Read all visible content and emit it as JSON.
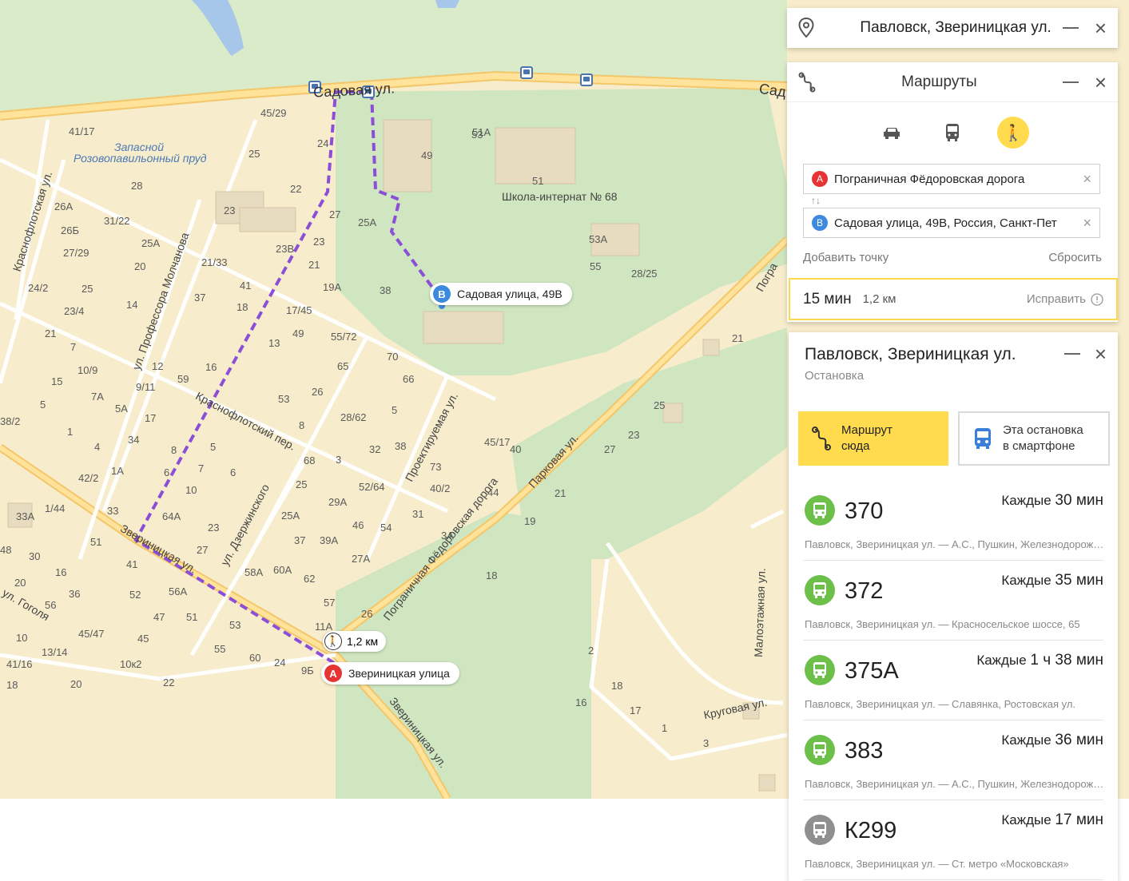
{
  "map": {
    "streets": [
      {
        "id": "sadovaya",
        "text": "Садовая ул."
      },
      {
        "id": "sad-edge",
        "text": "Сад"
      },
      {
        "id": "krasnoflotsky",
        "text": "Краснофлотский пер."
      },
      {
        "id": "molchanova",
        "text": "ул. Профессора Молчанова"
      },
      {
        "id": "dzerzhinskogo",
        "text": "ул. Дзержинского"
      },
      {
        "id": "proektiruemaya",
        "text": "Проектируемая ул."
      },
      {
        "id": "parkovaya",
        "text": "Парковая ул."
      },
      {
        "id": "pogranichnaya",
        "text": "Пограничная Фёдоровская дорога"
      },
      {
        "id": "zverinitskaya-a",
        "text": "Звериницкая ул."
      },
      {
        "id": "zverinitskaya-b",
        "text": "Звериницкая ул."
      },
      {
        "id": "gogolya",
        "text": "ул. Гоголя"
      },
      {
        "id": "krugovaya",
        "text": "Круговая ул."
      },
      {
        "id": "malоetazhnaya",
        "text": "Малоэтажная ул."
      },
      {
        "id": "krasnoflotskaya",
        "text": "Краснофлотская ул."
      },
      {
        "id": "pogra-edge",
        "text": "Погра"
      }
    ],
    "water": [
      "Запасной",
      "Розовопавильонный пруд"
    ],
    "school": "Школа-интернат № 68",
    "house_numbers": [
      "45/29",
      "41/17",
      "25",
      "24",
      "22",
      "28",
      "23",
      "27",
      "25А",
      "23В",
      "23",
      "21",
      "19А",
      "38",
      "49",
      "51А",
      "51",
      "53",
      "53А",
      "55",
      "28/25",
      "26А",
      "26Б",
      "27/29",
      "31/22",
      "25А",
      "20",
      "21/33",
      "41",
      "18",
      "17/45",
      "49",
      "55/72",
      "13",
      "37",
      "14",
      "25",
      "24/2",
      "23/4",
      "21",
      "7",
      "10/9",
      "9/11",
      "12",
      "16",
      "59",
      "70",
      "65",
      "66",
      "26",
      "53",
      "28/62",
      "8",
      "7А",
      "17",
      "15",
      "5",
      "5А",
      "34",
      "38/2",
      "1",
      "4",
      "1А",
      "6",
      "8",
      "5",
      "7",
      "10",
      "6",
      "5",
      "38",
      "32",
      "3",
      "68",
      "73",
      "45/17",
      "40",
      "42/2",
      "33",
      "1/44",
      "64А",
      "23",
      "25",
      "29А",
      "46",
      "54",
      "40/2",
      "44",
      "52/64",
      "31",
      "3А",
      "33А",
      "48",
      "51",
      "27",
      "25А",
      "27А",
      "37",
      "39А",
      "41",
      "52",
      "56А",
      "58А",
      "60А",
      "62",
      "57",
      "26",
      "18",
      "16",
      "30",
      "20",
      "36",
      "56",
      "45/47",
      "47",
      "45",
      "51",
      "53",
      "55",
      "60",
      "24",
      "9Б",
      "11А",
      "10к2",
      "10",
      "13/14",
      "41/16",
      "18",
      "20",
      "22",
      "21",
      "25",
      "27",
      "23",
      "21",
      "19",
      "2",
      "18",
      "17",
      "16",
      "1",
      "3"
    ],
    "route_start_label": "Звериницкая улица",
    "route_end_label": "Садовая улица, 49В",
    "route_distance": "1,2 км",
    "pin_a": "A",
    "pin_b": "B"
  },
  "stop_panel_top": {
    "title": "Павловск, Звериницкая ул."
  },
  "routes_panel": {
    "title": "Маршруты",
    "modes": [
      "car-icon",
      "bus-icon",
      "walk-icon"
    ],
    "active_mode": "walk-icon",
    "point_a": {
      "badge": "A",
      "value": "Пограничная Фёдоровская дорога"
    },
    "point_b": {
      "badge": "B",
      "value": "Садовая улица, 49В, Россия, Санкт-Пет"
    },
    "swap": "↑↓",
    "add_point": "Добавить точку",
    "reset": "Сбросить",
    "result": {
      "time": "15 мин",
      "distance": "1,2 км",
      "fix": "Исправить"
    }
  },
  "stop_card": {
    "title": "Павловск, Звериницкая ул.",
    "subtitle": "Остановка",
    "route_here": {
      "line1": "Маршрут",
      "line2": "сюда"
    },
    "to_phone": {
      "line1": "Эта остановка",
      "line2": "в смартфоне"
    },
    "routes": [
      {
        "number": "370",
        "freq_label": "Каждые",
        "freq_value": "30 мин",
        "path": "Павловск, Звериницкая ул. — А.С., Пушкин, Железнодорожная ул.",
        "color": "#6cc04a"
      },
      {
        "number": "372",
        "freq_label": "Каждые",
        "freq_value": "35 мин",
        "path": "Павловск, Звериницкая ул. — Красносельское шоссе, 65",
        "color": "#6cc04a"
      },
      {
        "number": "375А",
        "freq_label": "Каждые",
        "freq_value": "1 ч 38 мин",
        "path": "Павловск, Звериницкая ул. — Славянка, Ростовская ул.",
        "color": "#6cc04a"
      },
      {
        "number": "383",
        "freq_label": "Каждые",
        "freq_value": "36 мин",
        "path": "Павловск, Звериницкая ул. — А.С., Пушкин, Железнодорожная ул.",
        "color": "#6cc04a"
      },
      {
        "number": "К299",
        "freq_label": "Каждые",
        "freq_value": "17 мин",
        "path": "Павловск, Звериницкая ул. — Ст. метро «Московская»",
        "color": "#8f8f8f"
      }
    ]
  }
}
